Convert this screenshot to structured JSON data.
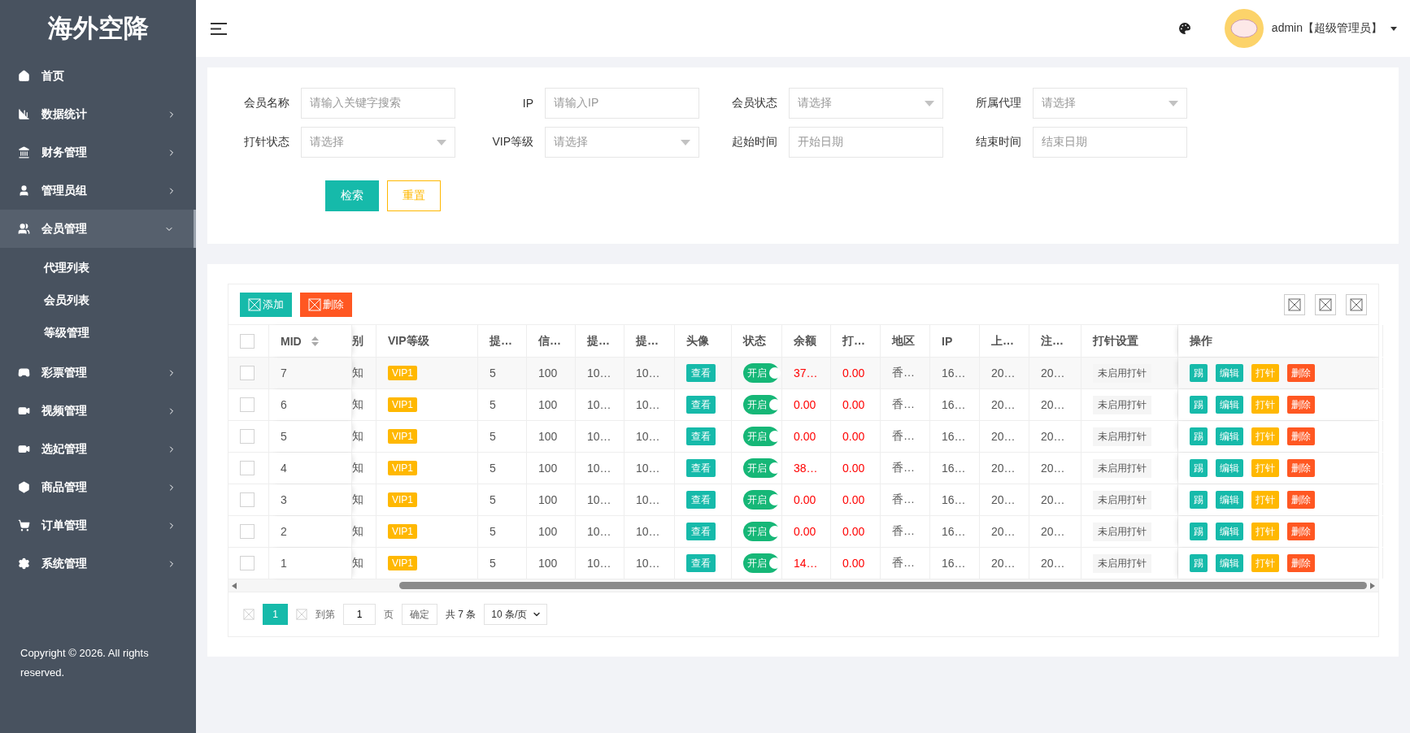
{
  "brand": "海外空降",
  "sidebar": {
    "items": [
      {
        "label": "首页"
      },
      {
        "label": "数据统计",
        "expanded": false
      },
      {
        "label": "财务管理",
        "expanded": false
      },
      {
        "label": "管理员组",
        "expanded": false
      },
      {
        "label": "会员管理",
        "expanded": true,
        "children": [
          {
            "label": "代理列表"
          },
          {
            "label": "会员列表"
          },
          {
            "label": "等级管理"
          }
        ]
      },
      {
        "label": "彩票管理",
        "expanded": false
      },
      {
        "label": "视频管理",
        "expanded": false
      },
      {
        "label": "选妃管理",
        "expanded": false
      },
      {
        "label": "商品管理",
        "expanded": false
      },
      {
        "label": "订单管理",
        "expanded": false
      },
      {
        "label": "系统管理",
        "expanded": false
      }
    ],
    "copyright": "Copyright © 2026. All rights reserved."
  },
  "header": {
    "user": "admin【超级管理员】"
  },
  "filters": [
    {
      "label": "会员名称",
      "kind": "input",
      "placeholder": "请输入关键字搜索"
    },
    {
      "label": "IP",
      "kind": "input",
      "placeholder": "请输入IP"
    },
    {
      "label": "会员状态",
      "kind": "select",
      "placeholder": "请选择"
    },
    {
      "label": "所属代理",
      "kind": "select",
      "placeholder": "请选择"
    },
    {
      "label": "打针状态",
      "kind": "select",
      "placeholder": "请选择"
    },
    {
      "label": "VIP等级",
      "kind": "select",
      "placeholder": "请选择"
    },
    {
      "label": "起始时间",
      "kind": "input",
      "placeholder": "开始日期"
    },
    {
      "label": "结束时间",
      "kind": "input",
      "placeholder": "结束日期"
    }
  ],
  "filter_buttons": {
    "search": "检索",
    "reset": "重置"
  },
  "toolbar": {
    "add": "添加",
    "delete": "删除"
  },
  "table": {
    "header_checked": false,
    "columns": [
      "MID",
      "别",
      "VIP等级",
      "提…",
      "信…",
      "提…",
      "提…",
      "头像",
      "状态",
      "余额",
      "打…",
      "地区",
      "IP",
      "上…",
      "注…",
      "打针设置",
      "操作"
    ],
    "rows": [
      {
        "checked": false,
        "cells": [
          {
            "kind": "text",
            "text": "7"
          },
          {
            "kind": "text",
            "text": "知"
          },
          {
            "kind": "badge",
            "text": "VIP1"
          },
          {
            "kind": "text",
            "text": "5"
          },
          {
            "kind": "text",
            "text": "100"
          },
          {
            "kind": "text",
            "text": "10…"
          },
          {
            "kind": "text",
            "text": "10…"
          },
          {
            "kind": "button",
            "text": "查看"
          },
          {
            "kind": "switch",
            "text": "开启",
            "on": true
          },
          {
            "kind": "amount",
            "text": "37…"
          },
          {
            "kind": "amount",
            "text": "0.00"
          },
          {
            "kind": "text",
            "text": "香…"
          },
          {
            "kind": "text",
            "text": "16…"
          },
          {
            "kind": "text",
            "text": "20…"
          },
          {
            "kind": "text",
            "text": "20…"
          },
          {
            "kind": "tag",
            "text": "未启用打针"
          }
        ],
        "actions": [
          {
            "kind": "primary",
            "text": "踢"
          },
          {
            "kind": "primary",
            "text": "编辑"
          },
          {
            "kind": "warm",
            "text": "打针"
          },
          {
            "kind": "danger",
            "text": "删除"
          }
        ]
      },
      {
        "checked": false,
        "cells": [
          {
            "kind": "text",
            "text": "6"
          },
          {
            "kind": "text",
            "text": "知"
          },
          {
            "kind": "badge",
            "text": "VIP1"
          },
          {
            "kind": "text",
            "text": "5"
          },
          {
            "kind": "text",
            "text": "100"
          },
          {
            "kind": "text",
            "text": "10…"
          },
          {
            "kind": "text",
            "text": "10…"
          },
          {
            "kind": "button",
            "text": "查看"
          },
          {
            "kind": "switch",
            "text": "开启",
            "on": true
          },
          {
            "kind": "amount",
            "text": "0.00"
          },
          {
            "kind": "amount",
            "text": "0.00"
          },
          {
            "kind": "text",
            "text": "香…"
          },
          {
            "kind": "text",
            "text": "16…"
          },
          {
            "kind": "text",
            "text": "20…"
          },
          {
            "kind": "text",
            "text": "20…"
          },
          {
            "kind": "tag",
            "text": "未启用打针"
          }
        ],
        "actions": [
          {
            "kind": "primary",
            "text": "踢"
          },
          {
            "kind": "primary",
            "text": "编辑"
          },
          {
            "kind": "warm",
            "text": "打针"
          },
          {
            "kind": "danger",
            "text": "删除"
          }
        ]
      },
      {
        "checked": false,
        "cells": [
          {
            "kind": "text",
            "text": "5"
          },
          {
            "kind": "text",
            "text": "知"
          },
          {
            "kind": "badge",
            "text": "VIP1"
          },
          {
            "kind": "text",
            "text": "5"
          },
          {
            "kind": "text",
            "text": "100"
          },
          {
            "kind": "text",
            "text": "10…"
          },
          {
            "kind": "text",
            "text": "10…"
          },
          {
            "kind": "button",
            "text": "查看"
          },
          {
            "kind": "switch",
            "text": "开启",
            "on": true
          },
          {
            "kind": "amount",
            "text": "0.00"
          },
          {
            "kind": "amount",
            "text": "0.00"
          },
          {
            "kind": "text",
            "text": "香…"
          },
          {
            "kind": "text",
            "text": "16…"
          },
          {
            "kind": "text",
            "text": "20…"
          },
          {
            "kind": "text",
            "text": "20…"
          },
          {
            "kind": "tag",
            "text": "未启用打针"
          }
        ],
        "actions": [
          {
            "kind": "primary",
            "text": "踢"
          },
          {
            "kind": "primary",
            "text": "编辑"
          },
          {
            "kind": "warm",
            "text": "打针"
          },
          {
            "kind": "danger",
            "text": "删除"
          }
        ]
      },
      {
        "checked": false,
        "cells": [
          {
            "kind": "text",
            "text": "4"
          },
          {
            "kind": "text",
            "text": "知"
          },
          {
            "kind": "badge",
            "text": "VIP1"
          },
          {
            "kind": "text",
            "text": "5"
          },
          {
            "kind": "text",
            "text": "100"
          },
          {
            "kind": "text",
            "text": "10…"
          },
          {
            "kind": "text",
            "text": "10…"
          },
          {
            "kind": "button",
            "text": "查看"
          },
          {
            "kind": "switch",
            "text": "开启",
            "on": true
          },
          {
            "kind": "amount",
            "text": "38…"
          },
          {
            "kind": "amount",
            "text": "0.00"
          },
          {
            "kind": "text",
            "text": "香…"
          },
          {
            "kind": "text",
            "text": "16…"
          },
          {
            "kind": "text",
            "text": "20…"
          },
          {
            "kind": "text",
            "text": "20…"
          },
          {
            "kind": "tag",
            "text": "未启用打针"
          }
        ],
        "actions": [
          {
            "kind": "primary",
            "text": "踢"
          },
          {
            "kind": "primary",
            "text": "编辑"
          },
          {
            "kind": "warm",
            "text": "打针"
          },
          {
            "kind": "danger",
            "text": "删除"
          }
        ]
      },
      {
        "checked": false,
        "cells": [
          {
            "kind": "text",
            "text": "3"
          },
          {
            "kind": "text",
            "text": "知"
          },
          {
            "kind": "badge",
            "text": "VIP1"
          },
          {
            "kind": "text",
            "text": "5"
          },
          {
            "kind": "text",
            "text": "100"
          },
          {
            "kind": "text",
            "text": "10…"
          },
          {
            "kind": "text",
            "text": "10…"
          },
          {
            "kind": "button",
            "text": "查看"
          },
          {
            "kind": "switch",
            "text": "开启",
            "on": true
          },
          {
            "kind": "amount",
            "text": "0.00"
          },
          {
            "kind": "amount",
            "text": "0.00"
          },
          {
            "kind": "text",
            "text": "香…"
          },
          {
            "kind": "text",
            "text": "16…"
          },
          {
            "kind": "text",
            "text": "20…"
          },
          {
            "kind": "text",
            "text": "20…"
          },
          {
            "kind": "tag",
            "text": "未启用打针"
          }
        ],
        "actions": [
          {
            "kind": "primary",
            "text": "踢"
          },
          {
            "kind": "primary",
            "text": "编辑"
          },
          {
            "kind": "warm",
            "text": "打针"
          },
          {
            "kind": "danger",
            "text": "删除"
          }
        ]
      },
      {
        "checked": false,
        "cells": [
          {
            "kind": "text",
            "text": "2"
          },
          {
            "kind": "text",
            "text": "知"
          },
          {
            "kind": "badge",
            "text": "VIP1"
          },
          {
            "kind": "text",
            "text": "5"
          },
          {
            "kind": "text",
            "text": "100"
          },
          {
            "kind": "text",
            "text": "10…"
          },
          {
            "kind": "text",
            "text": "10…"
          },
          {
            "kind": "button",
            "text": "查看"
          },
          {
            "kind": "switch",
            "text": "开启",
            "on": true
          },
          {
            "kind": "amount",
            "text": "0.00"
          },
          {
            "kind": "amount",
            "text": "0.00"
          },
          {
            "kind": "text",
            "text": "香…"
          },
          {
            "kind": "text",
            "text": "16…"
          },
          {
            "kind": "text",
            "text": "20…"
          },
          {
            "kind": "text",
            "text": "20…"
          },
          {
            "kind": "tag",
            "text": "未启用打针"
          }
        ],
        "actions": [
          {
            "kind": "primary",
            "text": "踢"
          },
          {
            "kind": "primary",
            "text": "编辑"
          },
          {
            "kind": "warm",
            "text": "打针"
          },
          {
            "kind": "danger",
            "text": "删除"
          }
        ]
      },
      {
        "checked": false,
        "cells": [
          {
            "kind": "text",
            "text": "1"
          },
          {
            "kind": "text",
            "text": "知"
          },
          {
            "kind": "badge",
            "text": "VIP1"
          },
          {
            "kind": "text",
            "text": "5"
          },
          {
            "kind": "text",
            "text": "100"
          },
          {
            "kind": "text",
            "text": "10…"
          },
          {
            "kind": "text",
            "text": "10…"
          },
          {
            "kind": "button",
            "text": "查看"
          },
          {
            "kind": "switch",
            "text": "开启",
            "on": true
          },
          {
            "kind": "amount",
            "text": "14…"
          },
          {
            "kind": "amount",
            "text": "0.00"
          },
          {
            "kind": "text",
            "text": "香…"
          },
          {
            "kind": "text",
            "text": "16…"
          },
          {
            "kind": "text",
            "text": "20…"
          },
          {
            "kind": "text",
            "text": "20…"
          },
          {
            "kind": "tag",
            "text": "未启用打针"
          }
        ],
        "actions": [
          {
            "kind": "primary",
            "text": "踢"
          },
          {
            "kind": "primary",
            "text": "编辑"
          },
          {
            "kind": "warm",
            "text": "打针"
          },
          {
            "kind": "danger",
            "text": "删除"
          }
        ]
      }
    ]
  },
  "pagination": {
    "pages": [
      {
        "label": "1",
        "selected": true
      }
    ],
    "goto_label": "到第",
    "goto_value": "1",
    "page_unit": "页",
    "confirm": "确定",
    "total": "共 7 条",
    "page_size": "10 条/页"
  }
}
